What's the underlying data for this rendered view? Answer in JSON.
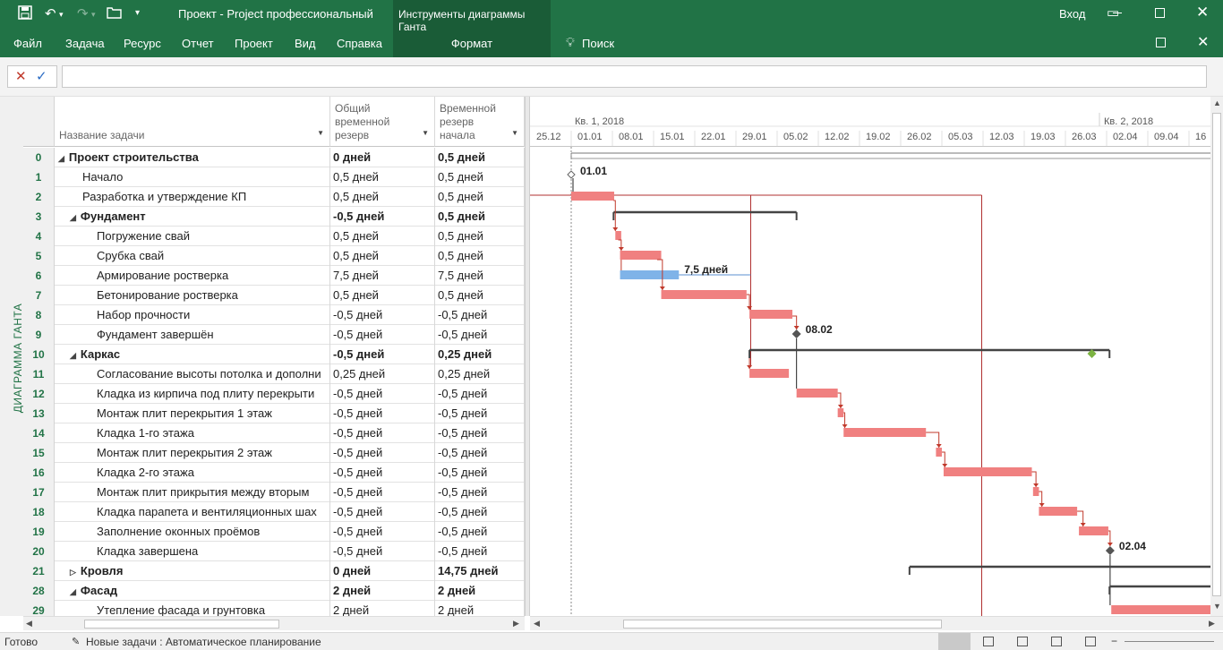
{
  "titlebar": {
    "title": "Проект - Project профессиональный",
    "signin": "Вход",
    "context_group": "Инструменты диаграммы Ганта"
  },
  "ribbon": {
    "tabs": [
      "Файл",
      "Задача",
      "Ресурс",
      "Отчет",
      "Проект",
      "Вид",
      "Справка"
    ],
    "context_tab": "Формат",
    "search": "Поиск"
  },
  "view_label": "ДИАГРАММА ГАНТА",
  "columns": {
    "name": "Название задачи",
    "total_slack_l1": "Общий",
    "total_slack_l2": "временной",
    "total_slack_l3": "резерв",
    "start_slack_l1": "Временной",
    "start_slack_l2": "резерв",
    "start_slack_l3": "начала"
  },
  "rows": [
    {
      "id": "0",
      "name": "Проект строительства",
      "slack": "0 дней",
      "start_slack": "0,5 дней",
      "bold": true,
      "level": 0,
      "toggle": "expanded"
    },
    {
      "id": "1",
      "name": "Начало",
      "slack": "0,5 дней",
      "start_slack": "0,5 дней",
      "bold": false,
      "level": 1
    },
    {
      "id": "2",
      "name": "Разработка и утверждение КП",
      "slack": "0,5 дней",
      "start_slack": "0,5 дней",
      "bold": false,
      "level": 1
    },
    {
      "id": "3",
      "name": "Фундамент",
      "slack": "-0,5 дней",
      "start_slack": "0,5 дней",
      "bold": true,
      "level": 1,
      "toggle": "expanded"
    },
    {
      "id": "4",
      "name": "Погружение свай",
      "slack": "0,5 дней",
      "start_slack": "0,5 дней",
      "bold": false,
      "level": 2
    },
    {
      "id": "5",
      "name": "Срубка свай",
      "slack": "0,5 дней",
      "start_slack": "0,5 дней",
      "bold": false,
      "level": 2
    },
    {
      "id": "6",
      "name": "Армирование ростверка",
      "slack": "7,5 дней",
      "start_slack": "7,5 дней",
      "bold": false,
      "level": 2
    },
    {
      "id": "7",
      "name": "Бетонирование ростверка",
      "slack": "0,5 дней",
      "start_slack": "0,5 дней",
      "bold": false,
      "level": 2
    },
    {
      "id": "8",
      "name": "Набор прочности",
      "slack": "-0,5 дней",
      "start_slack": "-0,5 дней",
      "bold": false,
      "level": 2
    },
    {
      "id": "9",
      "name": "Фундамент завершён",
      "slack": "-0,5 дней",
      "start_slack": "-0,5 дней",
      "bold": false,
      "level": 2
    },
    {
      "id": "10",
      "name": "Каркас",
      "slack": "-0,5 дней",
      "start_slack": "0,25 дней",
      "bold": true,
      "level": 1,
      "toggle": "expanded"
    },
    {
      "id": "11",
      "name": "Согласование высоты потолка и дополни",
      "slack": "0,25 дней",
      "start_slack": "0,25 дней",
      "bold": false,
      "level": 2
    },
    {
      "id": "12",
      "name": "Кладка из кирпича под плиту перекрыти",
      "slack": "-0,5 дней",
      "start_slack": "-0,5 дней",
      "bold": false,
      "level": 2
    },
    {
      "id": "13",
      "name": "Монтаж плит перекрытия 1 этаж",
      "slack": "-0,5 дней",
      "start_slack": "-0,5 дней",
      "bold": false,
      "level": 2
    },
    {
      "id": "14",
      "name": "Кладка 1-го этажа",
      "slack": "-0,5 дней",
      "start_slack": "-0,5 дней",
      "bold": false,
      "level": 2
    },
    {
      "id": "15",
      "name": "Монтаж плит перекрытия 2 этаж",
      "slack": "-0,5 дней",
      "start_slack": "-0,5 дней",
      "bold": false,
      "level": 2
    },
    {
      "id": "16",
      "name": "Кладка 2-го этажа",
      "slack": "-0,5 дней",
      "start_slack": "-0,5 дней",
      "bold": false,
      "level": 2
    },
    {
      "id": "17",
      "name": "Монтаж плит прикрытия между вторым",
      "slack": "-0,5 дней",
      "start_slack": "-0,5 дней",
      "bold": false,
      "level": 2
    },
    {
      "id": "18",
      "name": "Кладка парапета и вентиляционных шах",
      "slack": "-0,5 дней",
      "start_slack": "-0,5 дней",
      "bold": false,
      "level": 2
    },
    {
      "id": "19",
      "name": "Заполнение оконных проёмов",
      "slack": "-0,5 дней",
      "start_slack": "-0,5 дней",
      "bold": false,
      "level": 2
    },
    {
      "id": "20",
      "name": "Кладка завершена",
      "slack": "-0,5 дней",
      "start_slack": "-0,5 дней",
      "bold": false,
      "level": 2
    },
    {
      "id": "21",
      "name": "Кровля",
      "slack": "0 дней",
      "start_slack": "14,75 дней",
      "bold": true,
      "level": 1,
      "toggle": "collapsed"
    },
    {
      "id": "28",
      "name": "Фасад",
      "slack": "2 дней",
      "start_slack": "2 дней",
      "bold": true,
      "level": 1,
      "toggle": "expanded"
    },
    {
      "id": "29",
      "name": "Утепление фасада и грунтовка",
      "slack": "2 дней",
      "start_slack": "2 дней",
      "bold": false,
      "level": 2
    }
  ],
  "timescale": {
    "quarters": [
      {
        "label": "Кв. 1, 2018"
      },
      {
        "label": "Кв. 2, 2018"
      }
    ],
    "weeks": [
      "25.12",
      "01.01",
      "08.01",
      "15.01",
      "22.01",
      "29.01",
      "05.02",
      "12.02",
      "19.02",
      "26.02",
      "05.03",
      "12.03",
      "19.03",
      "26.03",
      "02.04",
      "09.04",
      "16"
    ]
  },
  "labels": {
    "milestone_start": "01.01",
    "slack_label": "7,5 дней",
    "milestone_found": "08.02",
    "milestone_masonry": "02.04"
  },
  "colors": {
    "accent": "#217346",
    "critical": "#f08080",
    "noncritical": "#7fb3e8",
    "summary": "#444444",
    "link": "#c0392b",
    "deadline": "#7cb342"
  },
  "status": {
    "ready": "Готово",
    "mode": "Новые задачи : Автоматическое планирование"
  }
}
